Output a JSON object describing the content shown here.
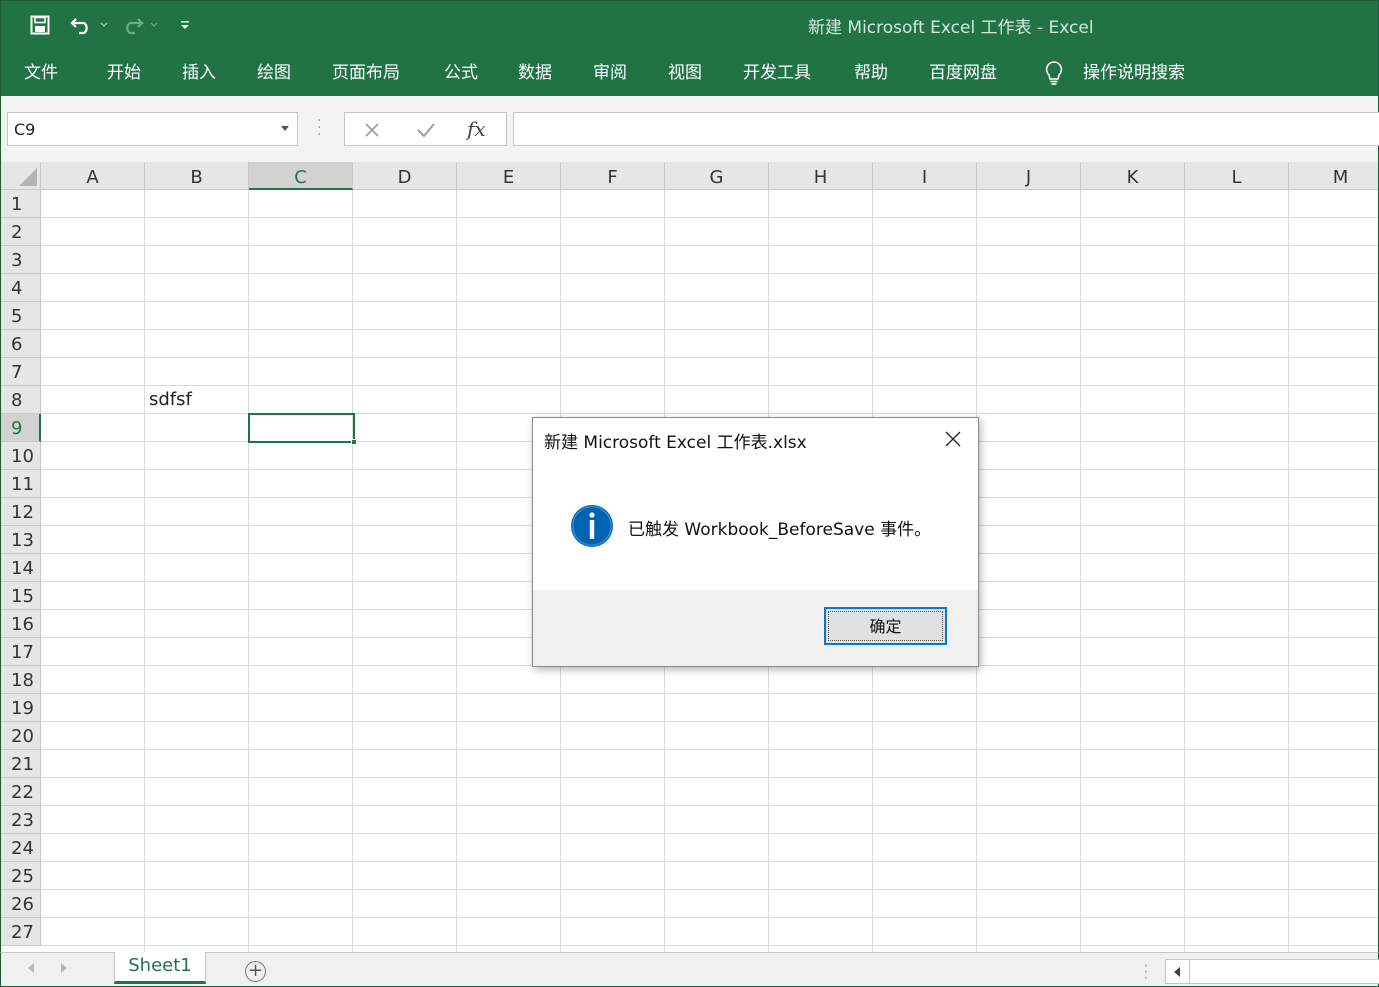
{
  "app": {
    "window_title": "新建 Microsoft Excel 工作表  -  Excel"
  },
  "quick_access": {
    "icons": [
      "save-icon",
      "undo-icon",
      "redo-icon",
      "customize-qat-icon"
    ]
  },
  "ribbon": {
    "tabs": [
      "文件",
      "开始",
      "插入",
      "绘图",
      "页面布局",
      "公式",
      "数据",
      "审阅",
      "视图",
      "开发工具",
      "帮助",
      "百度网盘"
    ],
    "tell_me": "操作说明搜索"
  },
  "formula_bar": {
    "name_box": "C9",
    "fx_label": "fx",
    "formula": ""
  },
  "grid": {
    "columns": [
      "A",
      "B",
      "C",
      "D",
      "E",
      "F",
      "G",
      "H",
      "I",
      "J",
      "K",
      "L",
      "M"
    ],
    "rows": [
      "1",
      "2",
      "3",
      "4",
      "5",
      "6",
      "7",
      "8",
      "9",
      "10",
      "11",
      "12",
      "13",
      "14",
      "15",
      "16",
      "17",
      "18",
      "19",
      "20",
      "21",
      "22",
      "23",
      "24",
      "25",
      "26",
      "27"
    ],
    "selected_column": "C",
    "selected_row": "9",
    "cells": {
      "B8": "sdfsf"
    }
  },
  "sheets": {
    "tabs": [
      "Sheet1"
    ],
    "active": "Sheet1"
  },
  "dialog": {
    "title": "新建 Microsoft Excel 工作表.xlsx",
    "message": "已触发 Workbook_BeforeSave 事件。",
    "ok_label": "确定",
    "icon": "info-icon"
  },
  "colors": {
    "excel_green": "#217346",
    "dialog_button_focus": "#0078d7",
    "info_blue": "#0063b1"
  }
}
